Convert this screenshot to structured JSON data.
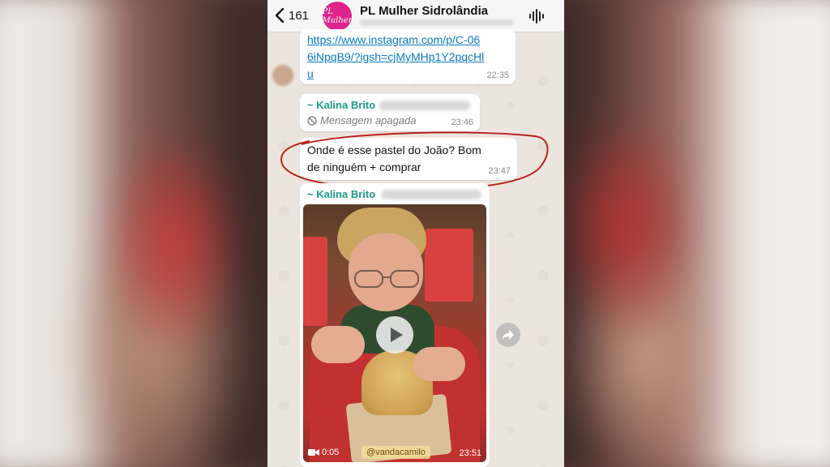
{
  "header": {
    "back_count": "161",
    "group_name": "PL Mulher Sidrolândia",
    "avatar_text": "PL Mulher"
  },
  "messages": {
    "link": {
      "text": "https://www.instagram.com/p/C-066iNpqB9/?igsh=cjMyMHp1Y2pqcHlu",
      "time": "22:35"
    },
    "deleted": {
      "sender": "~ Kalina Brito",
      "text": "Mensagem apagada",
      "time": "23:46"
    },
    "question": {
      "text": "Onde é esse pastel do João? Bom de ninguém + comprar",
      "time": "23:47"
    },
    "video": {
      "sender": "~ Kalina Brito",
      "duration": "0:05",
      "watermark": "@vandacamilo",
      "time": "23:51"
    }
  },
  "colors": {
    "sender_name": "#1b9a86",
    "link": "#0b7ac7",
    "annotation": "#b8231e"
  },
  "icons": {
    "back": "chevron-left-icon",
    "audio": "audio-wave-icon",
    "deleted": "block-icon",
    "play": "play-icon",
    "video": "video-camera-icon",
    "forward": "forward-icon"
  }
}
